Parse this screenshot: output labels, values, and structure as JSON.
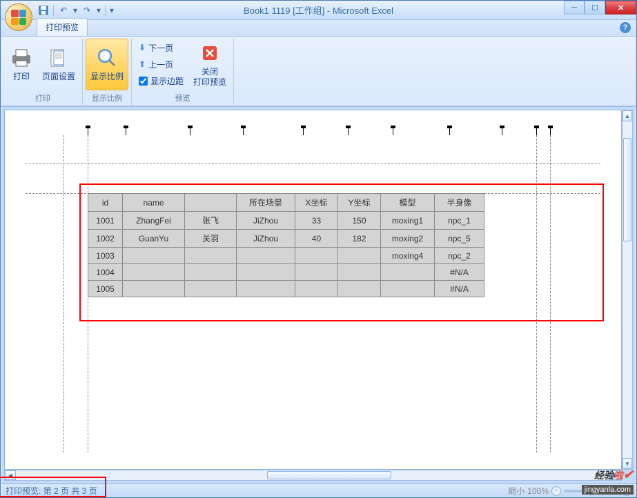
{
  "title": "Book1 1119  [工作组] - Microsoft Excel",
  "qat": {
    "save": "💾",
    "undo": "↶",
    "redo": "↷",
    "dropdown": "▾"
  },
  "tab": {
    "printPreview": "打印预览"
  },
  "ribbon": {
    "print": {
      "printBtn": "打印",
      "pageSetupBtn": "页面设置",
      "groupLabel": "打印"
    },
    "zoom": {
      "zoomBtn": "显示比例",
      "groupLabel": "显示比例"
    },
    "preview": {
      "nextPage": "下一页",
      "prevPage": "上一页",
      "showMargins": "显示边距",
      "closeBtn": "关闭\n打印预览",
      "groupLabel": "预览"
    }
  },
  "table": {
    "headers": {
      "id": "id",
      "name": "name",
      "cn": "",
      "scene": "所在场景",
      "x": "X坐标",
      "y": "Y坐标",
      "model": "模型",
      "avatar": "半身像"
    },
    "rows": [
      {
        "id": "1001",
        "name": "ZhangFei",
        "cn": "张飞",
        "scene": "JiZhou",
        "x": "33",
        "y": "150",
        "model": "moxing1",
        "avatar": "npc_1"
      },
      {
        "id": "1002",
        "name": "GuanYu",
        "cn": "关羽",
        "scene": "JiZhou",
        "x": "40",
        "y": "182",
        "model": "moxing2",
        "avatar": "npc_5"
      },
      {
        "id": "1003",
        "name": "",
        "cn": "",
        "scene": "",
        "x": "",
        "y": "",
        "model": "moxing4",
        "avatar": "npc_2"
      },
      {
        "id": "1004",
        "name": "",
        "cn": "",
        "scene": "",
        "x": "",
        "y": "",
        "model": "",
        "avatar": "#N/A"
      },
      {
        "id": "1005",
        "name": "",
        "cn": "",
        "scene": "",
        "x": "",
        "y": "",
        "model": "",
        "avatar": "#N/A"
      }
    ]
  },
  "status": {
    "pageInfo": "打印预览: 第 2 页  共 3 页",
    "zoomLabel": "缩小",
    "zoomPct": "100%"
  },
  "watermark": {
    "text1": "经验",
    "text2": "啦",
    "url": "jingyanla.com"
  },
  "showMarginsChecked": true
}
